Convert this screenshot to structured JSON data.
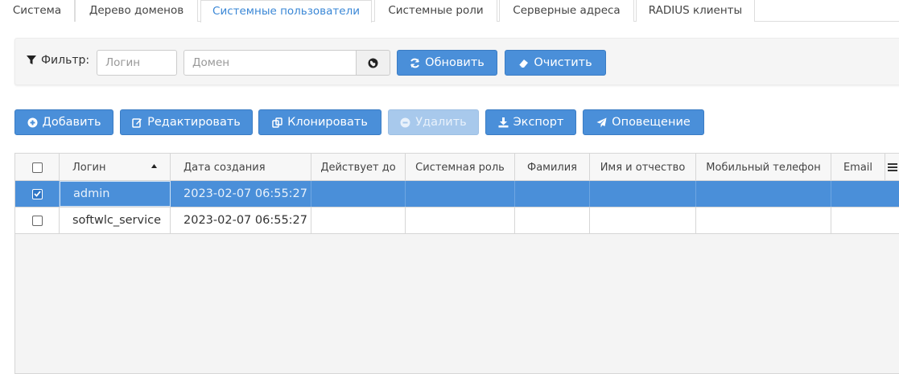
{
  "tabs": [
    {
      "label": "Система"
    },
    {
      "label": "Дерево доменов"
    },
    {
      "label": "Системные пользователи",
      "active": true
    },
    {
      "label": "Системные роли"
    },
    {
      "label": "Серверные адреса"
    },
    {
      "label": "RADIUS клиенты"
    }
  ],
  "filter": {
    "label": "Фильтр:",
    "login_placeholder": "Логин",
    "domain_placeholder": "Домен",
    "refresh_label": "Обновить",
    "clear_label": "Очистить"
  },
  "toolbar": {
    "add_label": "Добавить",
    "edit_label": "Редактировать",
    "clone_label": "Клонировать",
    "delete_label": "Удалить",
    "export_label": "Экспорт",
    "notify_label": "Оповещение"
  },
  "table": {
    "columns": [
      "Логин",
      "Дата создания",
      "Действует до",
      "Системная роль",
      "Фамилия",
      "Имя и отчество",
      "Мобильный телефон",
      "Email"
    ],
    "sort_column": "Логин",
    "rows": [
      {
        "login": "admin",
        "created": "2023-02-07 06:55:27",
        "checked": true,
        "selected": true
      },
      {
        "login": "softwlc_service",
        "created": "2023-02-07 06:55:27",
        "checked": false,
        "selected": false
      }
    ]
  },
  "colors": {
    "accent": "#4a8fd9",
    "active_tab": "#3a87d6"
  }
}
